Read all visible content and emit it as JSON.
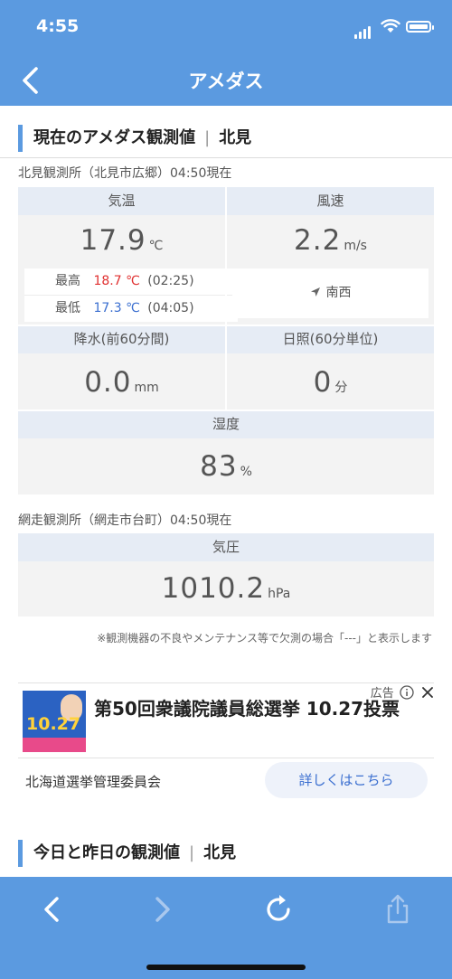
{
  "status": {
    "time": "4:55"
  },
  "header": {
    "title": "アメダス"
  },
  "current": {
    "heading": "現在のアメダス観測値",
    "area": "北見",
    "station1": "北見観測所（北見市広郷）04:50現在",
    "temp": {
      "label": "気温",
      "value": "17.9",
      "unit": "℃",
      "max_label": "最高",
      "max_value": "18.7 ℃",
      "max_time": "(02:25)",
      "min_label": "最低",
      "min_value": "17.3 ℃",
      "min_time": "(04:05)"
    },
    "wind": {
      "label": "風速",
      "value": "2.2",
      "unit": "m/s",
      "direction": "南西"
    },
    "precip": {
      "label": "降水(前60分間)",
      "value": "0.0",
      "unit": "mm"
    },
    "sun": {
      "label": "日照(60分単位)",
      "value": "0",
      "unit": "分"
    },
    "humidity": {
      "label": "湿度",
      "value": "83",
      "unit": "%"
    },
    "station2": "網走観測所（網走市台町）04:50現在",
    "pressure": {
      "label": "気圧",
      "value": "1010.2",
      "unit": "hPa"
    },
    "note": "※観測機器の不良やメンテナンス等で欠測の場合「---」と表示します"
  },
  "ad": {
    "badge": "広告",
    "thumb_text": "10.27",
    "headline": "第50回衆議院議員総選挙 10.27投票",
    "advertiser": "北海道選挙管理委員会",
    "cta": "詳しくはこちら"
  },
  "history": {
    "heading": "今日と昨日の観測値",
    "area": "北見"
  }
}
